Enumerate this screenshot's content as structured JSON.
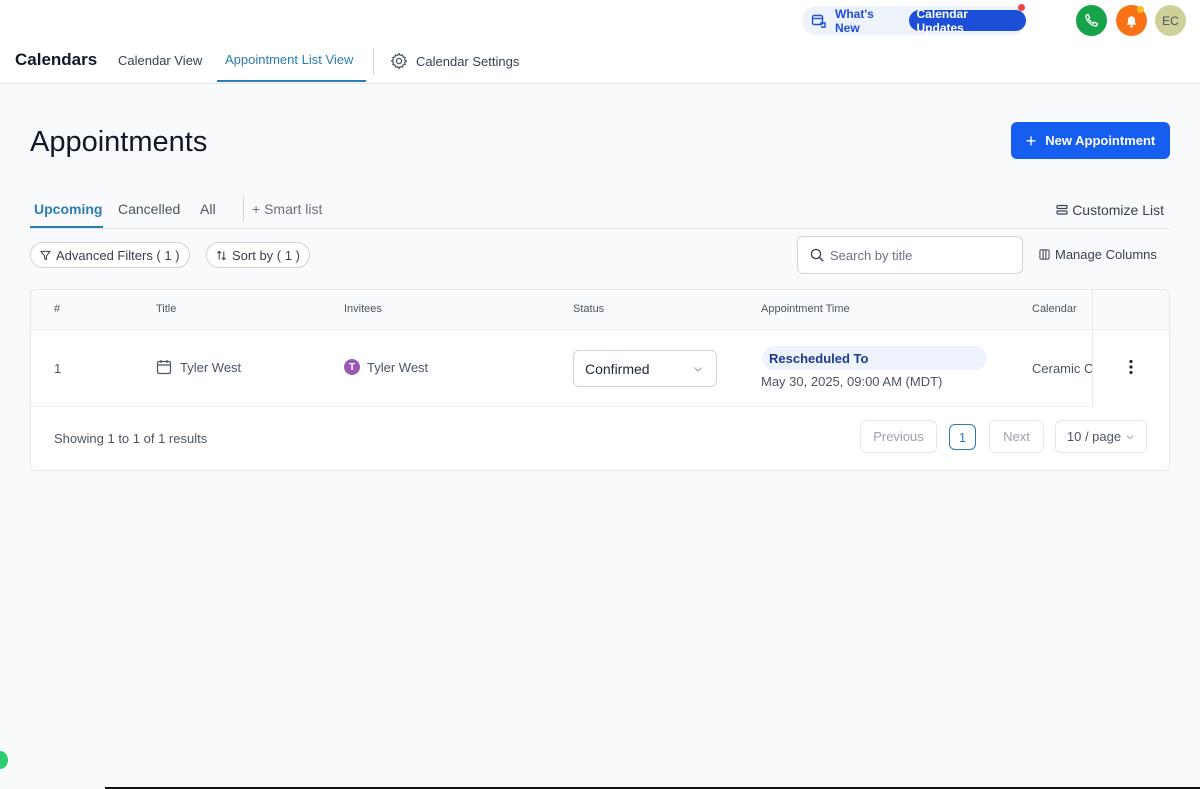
{
  "topbar": {
    "whats_new": "What's New",
    "calendar_updates": "Calendar Updates",
    "avatar_initials": "EC"
  },
  "nav": {
    "brand": "Calendars",
    "tabs": [
      {
        "label": "Calendar View"
      },
      {
        "label": "Appointment List View",
        "active": true
      }
    ],
    "settings": "Calendar Settings"
  },
  "page": {
    "title": "Appointments",
    "new_button": "New Appointment"
  },
  "subtabs": {
    "items": [
      {
        "label": "Upcoming",
        "active": true
      },
      {
        "label": "Cancelled"
      },
      {
        "label": "All"
      }
    ],
    "smart_list": "+ Smart list",
    "customize": "Customize List"
  },
  "filters": {
    "advanced": "Advanced Filters ( 1 )",
    "sort": "Sort by ( 1 )",
    "search_placeholder": "Search by title",
    "manage_columns": "Manage Columns"
  },
  "table": {
    "columns": [
      "#",
      "Title",
      "Invitees",
      "Status",
      "Appointment Time",
      "Calendar"
    ],
    "rows": [
      {
        "index": "1",
        "title": "Tyler West",
        "invitee_initial": "T",
        "invitee": "Tyler West",
        "status": "Confirmed",
        "time_badge": "Rescheduled To",
        "time": "May 30, 2025, 09:00 AM (MDT)",
        "calendar": "Ceramic C"
      }
    ]
  },
  "footer": {
    "showing": "Showing 1 to 1 of 1 results",
    "previous": "Previous",
    "page": "1",
    "next": "Next",
    "page_size": "10 / page"
  },
  "colors": {
    "primary": "#155eef",
    "active_tab": "#2b7db5",
    "phone": "#16a34a",
    "bell": "#f97316",
    "invitee_avatar": "#9b59b6"
  }
}
